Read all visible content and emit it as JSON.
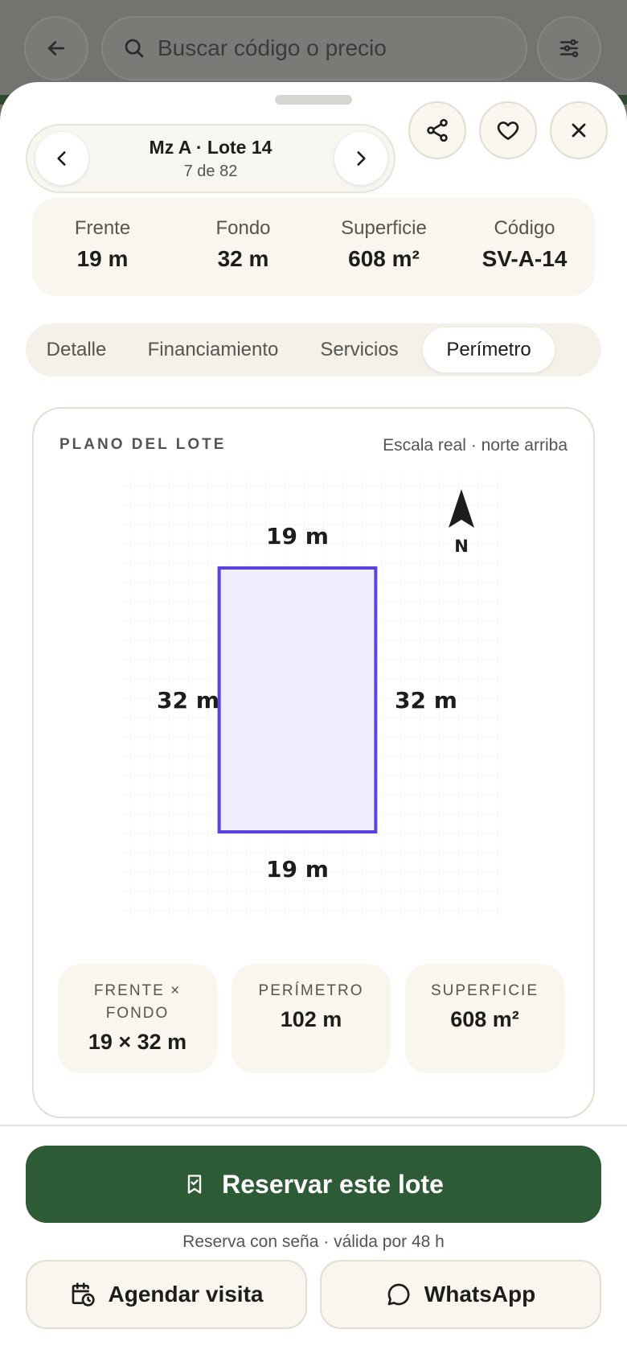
{
  "search": {
    "placeholder": "Buscar código o precio"
  },
  "lot": {
    "title": "Mz A · Lote 14",
    "position": "7 de 82"
  },
  "stats": [
    {
      "label": "Frente",
      "value": "19 m"
    },
    {
      "label": "Fondo",
      "value": "32 m"
    },
    {
      "label": "Superficie",
      "value": "608 m²"
    },
    {
      "label": "Código",
      "value": "SV-A-14"
    }
  ],
  "tabs": [
    {
      "label": "Detalle",
      "active": false
    },
    {
      "label": "Financiamiento",
      "active": false
    },
    {
      "label": "Servicios",
      "active": false
    },
    {
      "label": "Perímetro",
      "active": true
    }
  ],
  "plan": {
    "label": "PLANO DEL LOTE",
    "note": "Escala real · norte arriba",
    "north": "N",
    "front_m": 19,
    "depth_m": 32,
    "top_label": "19 m",
    "bottom_label": "19 m",
    "left_label": "32 m",
    "right_label": "32 m",
    "fill_color": "#efeefc",
    "stroke_color": "#5a43e0"
  },
  "summary": [
    {
      "label_line1": "FRENTE ×",
      "label_line2": "FONDO",
      "value": "19 × 32 m"
    },
    {
      "label_line1": "PERÍMETRO",
      "label_line2": "",
      "value": "102 m"
    },
    {
      "label_line1": "SUPERFICIE",
      "label_line2": "",
      "value": "608 m²"
    }
  ],
  "reserve": {
    "label": "Reservar este lote",
    "note": "Reserva con seña · válida por 48 h",
    "color": "#2d5b35"
  },
  "buttons": {
    "schedule": "Agendar visita",
    "whatsapp": "WhatsApp"
  },
  "icons": {
    "back": "arrow-left-icon",
    "search": "search-icon",
    "filters": "sliders-icon",
    "prev": "chevron-left-icon",
    "next": "chevron-right-icon",
    "share": "share-icon",
    "favorite": "heart-icon",
    "close": "close-icon",
    "bookmark": "bookmark-icon",
    "calendar": "calendar-clock-icon",
    "chat": "chat-bubble-icon"
  }
}
